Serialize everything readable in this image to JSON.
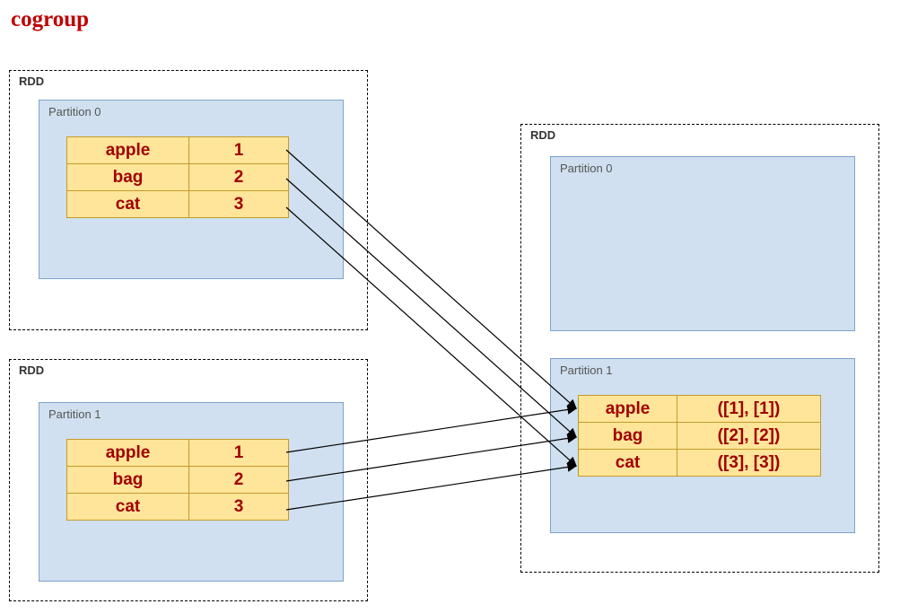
{
  "title": "cogroup",
  "left_top": {
    "rdd_label": "RDD",
    "partition_label": "Partition 0",
    "rows": [
      {
        "key": "apple",
        "value": "1"
      },
      {
        "key": "bag",
        "value": "2"
      },
      {
        "key": "cat",
        "value": "3"
      }
    ]
  },
  "left_bottom": {
    "rdd_label": "RDD",
    "partition_label": "Partition 1",
    "rows": [
      {
        "key": "apple",
        "value": "1"
      },
      {
        "key": "bag",
        "value": "2"
      },
      {
        "key": "cat",
        "value": "3"
      }
    ]
  },
  "right": {
    "rdd_label": "RDD",
    "partition0_label": "Partition 0",
    "partition1_label": "Partition 1",
    "rows": [
      {
        "key": "apple",
        "value": "([1], [1])"
      },
      {
        "key": "bag",
        "value": "([2], [2])"
      },
      {
        "key": "cat",
        "value": "([3], [3])"
      }
    ]
  },
  "chart_data": {
    "type": "table",
    "operation": "cogroup",
    "inputs": [
      {
        "rdd": "RDD",
        "partition": "Partition 0",
        "pairs": [
          [
            "apple",
            1
          ],
          [
            "bag",
            2
          ],
          [
            "cat",
            3
          ]
        ]
      },
      {
        "rdd": "RDD",
        "partition": "Partition 1",
        "pairs": [
          [
            "apple",
            1
          ],
          [
            "bag",
            2
          ],
          [
            "cat",
            3
          ]
        ]
      }
    ],
    "output": {
      "rdd": "RDD",
      "partitions": [
        {
          "name": "Partition 0",
          "pairs": []
        },
        {
          "name": "Partition 1",
          "pairs": [
            [
              "apple",
              "([1], [1])"
            ],
            [
              "bag",
              "([2], [2])"
            ],
            [
              "cat",
              "([3], [3])"
            ]
          ]
        }
      ]
    },
    "arrows": [
      {
        "from": "left_top.row0",
        "to": "right.row0"
      },
      {
        "from": "left_top.row1",
        "to": "right.row1"
      },
      {
        "from": "left_top.row2",
        "to": "right.row2"
      },
      {
        "from": "left_bottom.row0",
        "to": "right.row0"
      },
      {
        "from": "left_bottom.row1",
        "to": "right.row1"
      },
      {
        "from": "left_bottom.row2",
        "to": "right.row2"
      }
    ]
  }
}
